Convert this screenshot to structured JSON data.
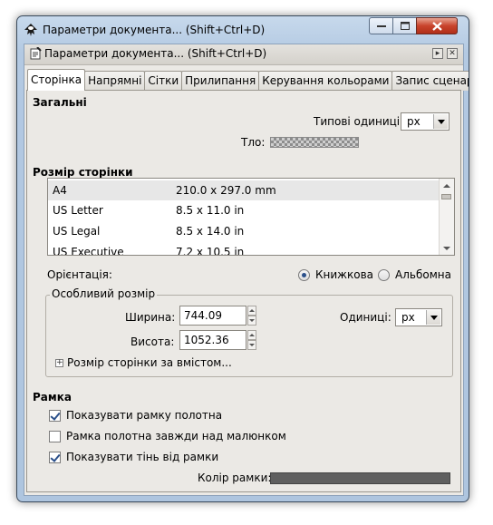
{
  "window": {
    "title": "Параметри документа... (Shift+Ctrl+D)"
  },
  "dock": {
    "title": "Параметри документа... (Shift+Ctrl+D)"
  },
  "tabs": [
    {
      "label": "Сторінка",
      "active": true
    },
    {
      "label": "Напрямні",
      "active": false
    },
    {
      "label": "Сітки",
      "active": false
    },
    {
      "label": "Прилипання",
      "active": false
    },
    {
      "label": "Керування кольорами",
      "active": false
    },
    {
      "label": "Запис сценаріїв",
      "active": false
    }
  ],
  "general": {
    "heading": "Загальні",
    "default_units_label": "Типові одиниці:",
    "default_units_value": "px",
    "background_label": "Тло:"
  },
  "page_size": {
    "heading": "Розмір сторінки",
    "rows": [
      {
        "name": "A4",
        "size": "210.0 x 297.0 mm"
      },
      {
        "name": "US Letter",
        "size": "8.5 x 11.0 in"
      },
      {
        "name": "US Legal",
        "size": "8.5 x 14.0 in"
      },
      {
        "name": "US Executive",
        "size": "7.2 x 10.5 in"
      }
    ],
    "orientation_label": "Орієнтація:",
    "portrait_label": "Книжкова",
    "landscape_label": "Альбомна",
    "portrait_selected": true
  },
  "custom_size": {
    "title": "Особливий розмір",
    "width_label": "Ширина:",
    "width_value": "744.09",
    "height_label": "Висота:",
    "height_value": "1052.36",
    "units_label": "Одиниці:",
    "units_value": "px",
    "fit_label": "Розмір сторінки за вмістом..."
  },
  "border": {
    "heading": "Рамка",
    "show_border_label": "Показувати рамку полотна",
    "show_border_checked": true,
    "border_on_top_label": "Рамка полотна завжди над малюнком",
    "border_on_top_checked": false,
    "show_shadow_label": "Показувати тінь від рамки",
    "show_shadow_checked": true,
    "border_color_label": "Колір рамки:",
    "border_color": "#5f5f5f"
  },
  "colors": {
    "accent": "#2a4f8a",
    "close_button": "#c8432c"
  }
}
